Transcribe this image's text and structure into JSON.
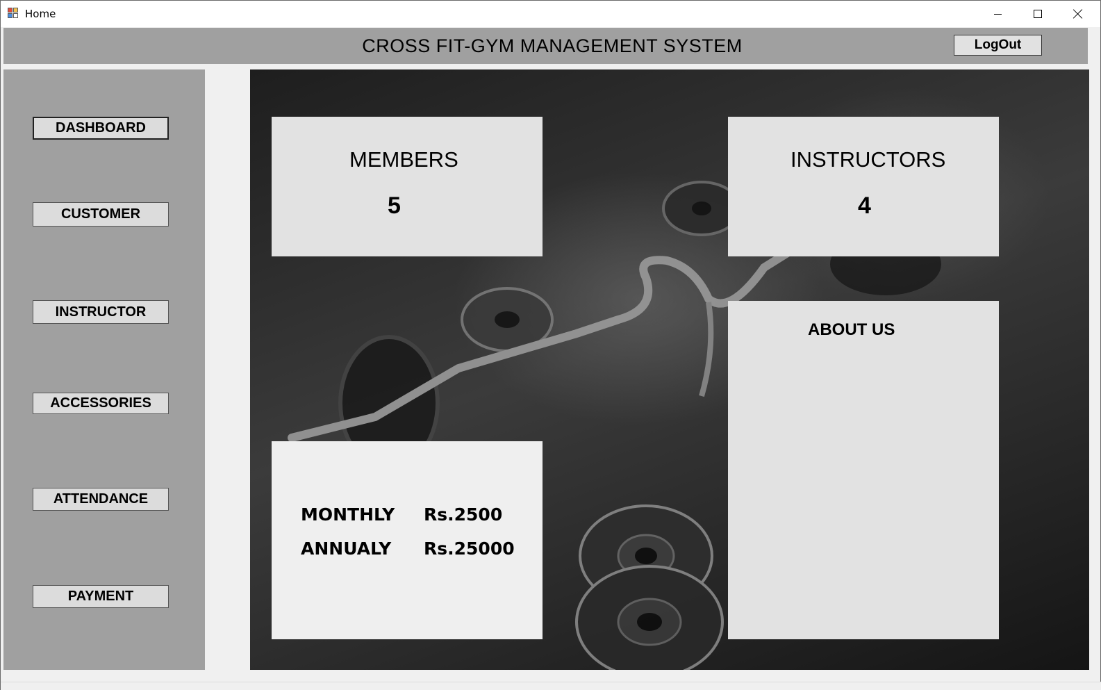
{
  "window": {
    "title": "Home"
  },
  "header": {
    "title": "CROSS FIT-GYM MANAGEMENT SYSTEM",
    "logout_label": "LogOut"
  },
  "sidebar": {
    "items": [
      {
        "label": "DASHBOARD",
        "active": true
      },
      {
        "label": "CUSTOMER"
      },
      {
        "label": "INSTRUCTOR"
      },
      {
        "label": "ACCESSORIES"
      },
      {
        "label": "ATTENDANCE"
      },
      {
        "label": "PAYMENT"
      }
    ]
  },
  "dashboard": {
    "members": {
      "label": "MEMBERS",
      "count": "5"
    },
    "instructors": {
      "label": "INSTRUCTORS",
      "count": "4"
    },
    "about": {
      "label": "ABOUT US"
    },
    "pricing": [
      {
        "plan": "MONTHLY",
        "price": "Rs.2500"
      },
      {
        "plan": "ANNUALY",
        "price": "Rs.25000"
      }
    ]
  }
}
